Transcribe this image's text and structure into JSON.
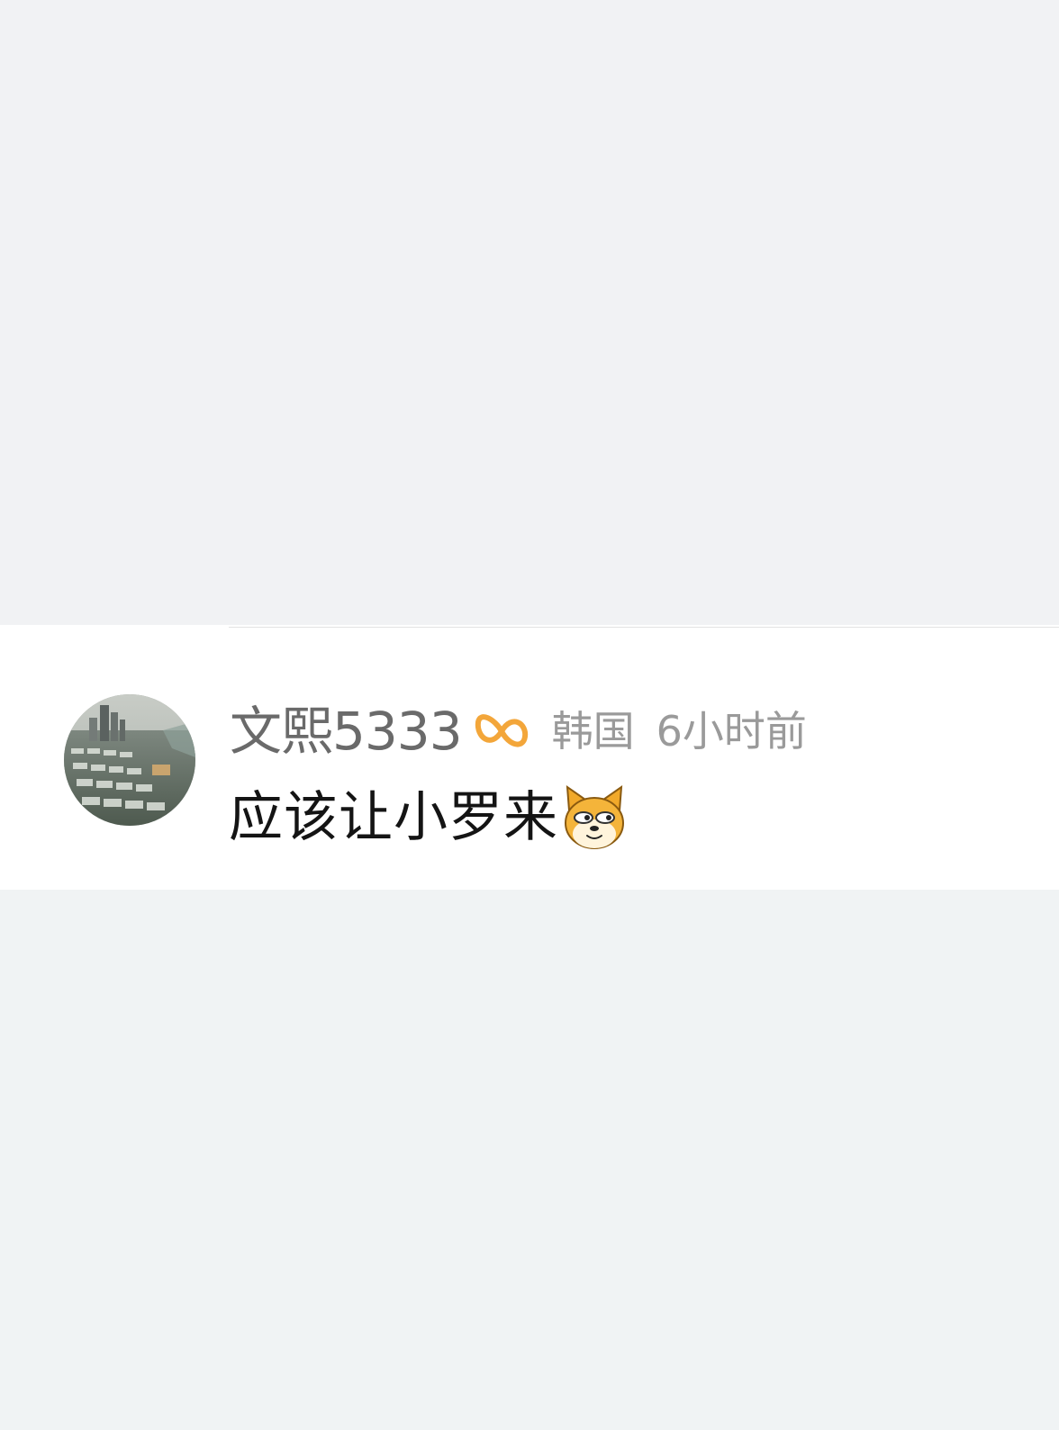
{
  "comment": {
    "username": "文熙5333",
    "badge_icon": "vip-infinity-icon",
    "location": "韩国",
    "time": "6小时前",
    "text": "应该让小罗来",
    "emoji_icon": "doge-emoji-icon"
  },
  "colors": {
    "background": "#f1f3f4",
    "card": "#ffffff",
    "username": "#6a6a6a",
    "meta": "#9a9a9a",
    "text": "#141414",
    "badge": "#f3a63a"
  }
}
